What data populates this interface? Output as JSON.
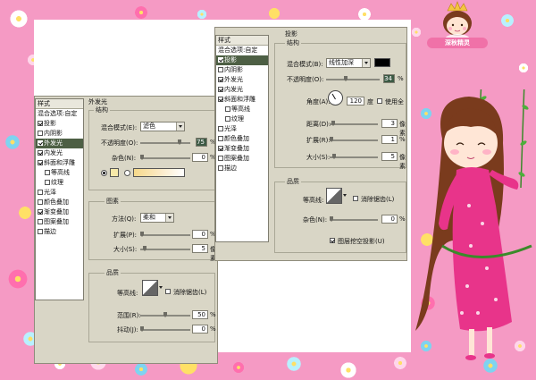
{
  "colors": {
    "background_pink": "#f59ac4",
    "panel_gray": "#d9d6c6",
    "selection_green": "#4d5f44",
    "dress_pink": "#e8348a"
  },
  "logo": {
    "text": "深秋精灵"
  },
  "dialog_left": {
    "styles_list": [
      {
        "label": "样式",
        "type": "header"
      },
      {
        "label": "混合选项:自定",
        "type": "plain"
      },
      {
        "label": "投影",
        "checked": true
      },
      {
        "label": "内阴影",
        "checked": false
      },
      {
        "label": "外发光",
        "checked": true,
        "selected": true
      },
      {
        "label": "内发光",
        "checked": true
      },
      {
        "label": "斜面和浮雕",
        "checked": true
      },
      {
        "label": "等高线",
        "checked": false,
        "indent": true
      },
      {
        "label": "纹理",
        "checked": false,
        "indent": true
      },
      {
        "label": "光泽",
        "checked": false
      },
      {
        "label": "颜色叠加",
        "checked": false
      },
      {
        "label": "渐变叠加",
        "checked": true
      },
      {
        "label": "图案叠加",
        "checked": false
      },
      {
        "label": "描边",
        "checked": false
      }
    ],
    "section_title": "外发光",
    "structure": {
      "title": "结构",
      "blend_mode_label": "混合模式(E):",
      "blend_mode_value": "滤色",
      "opacity_label": "不透明度(O):",
      "opacity_value": "75",
      "noise_label": "杂色(N):",
      "noise_value": "0",
      "percent": "%"
    },
    "elements": {
      "title": "图素",
      "method_label": "方法(Q):",
      "method_value": "柔和",
      "spread_label": "扩展(P):",
      "spread_value": "0",
      "size_label": "大小(S):",
      "size_value": "5",
      "percent": "%",
      "px": "像素"
    },
    "quality": {
      "title": "品质",
      "contour_label": "等高线:",
      "antialias_label": "消除锯齿(L)",
      "range_label": "范围(R):",
      "range_value": "50",
      "jitter_label": "抖动(J):",
      "jitter_value": "0",
      "percent": "%"
    }
  },
  "dialog_right": {
    "styles_list": [
      {
        "label": "样式",
        "type": "header"
      },
      {
        "label": "混合选项:自定",
        "type": "plain"
      },
      {
        "label": "投影",
        "checked": true,
        "selected": true
      },
      {
        "label": "内阴影",
        "checked": false
      },
      {
        "label": "外发光",
        "checked": true
      },
      {
        "label": "内发光",
        "checked": true
      },
      {
        "label": "斜面和浮雕",
        "checked": true
      },
      {
        "label": "等高线",
        "checked": false,
        "indent": true
      },
      {
        "label": "纹理",
        "checked": false,
        "indent": true
      },
      {
        "label": "光泽",
        "checked": false
      },
      {
        "label": "颜色叠加",
        "checked": false
      },
      {
        "label": "渐变叠加",
        "checked": true
      },
      {
        "label": "图案叠加",
        "checked": false
      },
      {
        "label": "描边",
        "checked": false
      }
    ],
    "section_title": "投影",
    "structure": {
      "title": "结构",
      "blend_mode_label": "混合模式(B):",
      "blend_mode_value": "线性加深",
      "opacity_label": "不透明度(O):",
      "opacity_value": "34",
      "angle_label": "角度(A):",
      "angle_value": "120",
      "degree": "度",
      "global_light_label": "使用全",
      "distance_label": "距离(D):",
      "distance_value": "3",
      "spread_label": "扩展(R):",
      "spread_value": "1",
      "size_label": "大小(S):",
      "size_value": "5",
      "percent": "%",
      "px": "像素"
    },
    "quality": {
      "title": "品质",
      "contour_label": "等高线:",
      "antialias_label": "消除锯齿(L)",
      "noise_label": "杂色(N):",
      "noise_value": "0",
      "knockout_label": "图层挖空投影(U)",
      "percent": "%"
    }
  }
}
